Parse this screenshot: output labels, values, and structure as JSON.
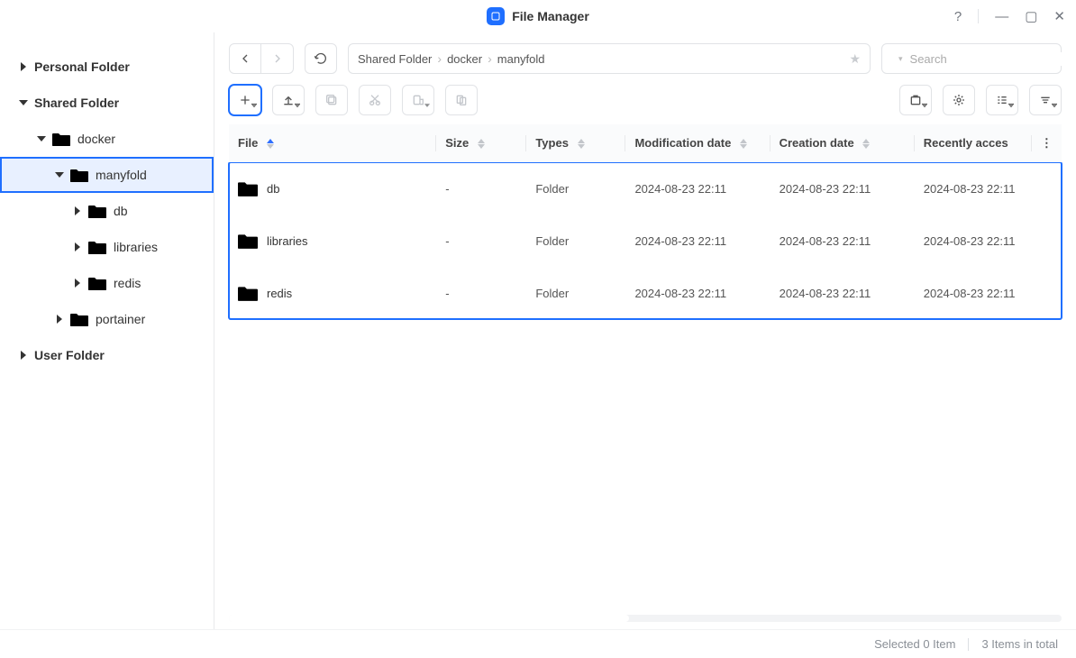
{
  "app": {
    "title": "File Manager"
  },
  "window_controls": {
    "help": "?",
    "minimize": "—",
    "maximize": "▢",
    "close": "✕"
  },
  "sidebar": {
    "roots": [
      {
        "label": "Personal Folder",
        "expanded": false
      },
      {
        "label": "Shared Folder",
        "expanded": true,
        "children": [
          {
            "label": "docker",
            "expanded": true,
            "children": [
              {
                "label": "manyfold",
                "expanded": true,
                "selected": true,
                "children": [
                  {
                    "label": "db"
                  },
                  {
                    "label": "libraries"
                  },
                  {
                    "label": "redis"
                  }
                ]
              },
              {
                "label": "portainer"
              }
            ]
          }
        ]
      },
      {
        "label": "User Folder",
        "expanded": false
      }
    ]
  },
  "breadcrumb": {
    "items": [
      "Shared Folder",
      "docker",
      "manyfold"
    ]
  },
  "search": {
    "placeholder": "Search"
  },
  "columns": {
    "file": "File",
    "size": "Size",
    "types": "Types",
    "mod": "Modification date",
    "created": "Creation date",
    "accessed": "Recently acces"
  },
  "rows": [
    {
      "name": "db",
      "size": "-",
      "type": "Folder",
      "mod": "2024-08-23 22:11",
      "created": "2024-08-23 22:11",
      "accessed": "2024-08-23 22:11"
    },
    {
      "name": "libraries",
      "size": "-",
      "type": "Folder",
      "mod": "2024-08-23 22:11",
      "created": "2024-08-23 22:11",
      "accessed": "2024-08-23 22:11"
    },
    {
      "name": "redis",
      "size": "-",
      "type": "Folder",
      "mod": "2024-08-23 22:11",
      "created": "2024-08-23 22:11",
      "accessed": "2024-08-23 22:11"
    }
  ],
  "status": {
    "selected": "Selected 0 Item",
    "total": "3 Items in total"
  }
}
